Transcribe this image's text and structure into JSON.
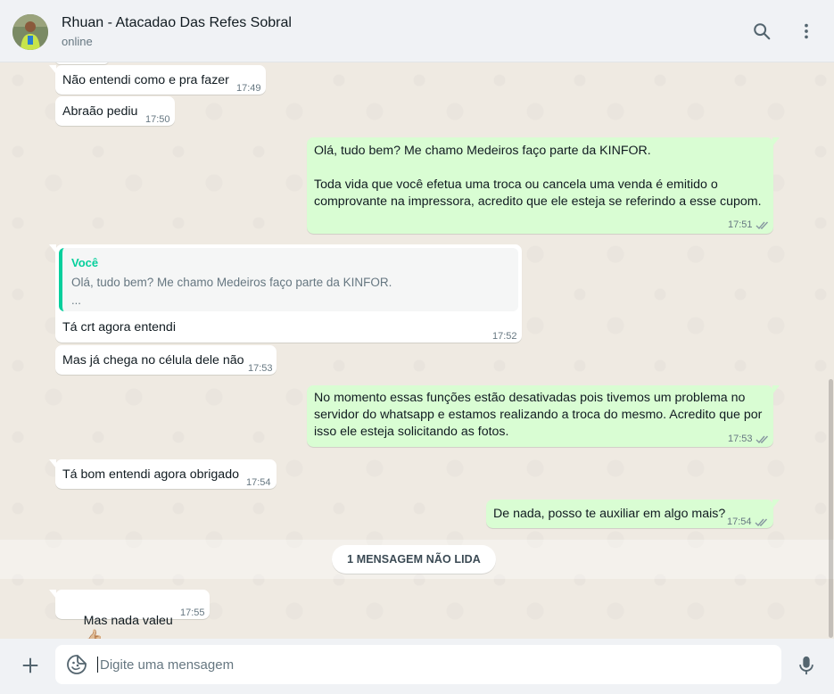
{
  "header": {
    "contact_name": "Rhuan - Atacadao Das Refes Sobral",
    "status": "online",
    "icons": [
      "search-icon",
      "menu-dots-icon"
    ]
  },
  "messages": [
    {
      "direction": "in",
      "text": "Não entendi como e pra fazer",
      "time": "17:49"
    },
    {
      "direction": "in",
      "text": "Abraão pediu",
      "time": "17:50"
    },
    {
      "direction": "out",
      "text": "Olá, tudo bem? Me chamo Medeiros faço parte da KINFOR.\n\nToda vida que você efetua uma troca ou cancela uma venda é emitido o\ncomprovante na impressora, acredito que ele esteja se referindo a esse cupom.",
      "time": "17:51",
      "status": "read"
    },
    {
      "direction": "in",
      "quote": {
        "author": "Você",
        "text": "Olá, tudo bem? Me chamo Medeiros faço parte da KINFOR.",
        "more": "..."
      },
      "text": "Tá crt agora entendi",
      "time": "17:52"
    },
    {
      "direction": "in",
      "text": "Mas já chega no célula dele não",
      "time": "17:53"
    },
    {
      "direction": "out",
      "text": "No momento essas funções estão desativadas pois tivemos um problema no\nservidor do whatsapp e estamos realizando a troca do mesmo. Acredito que por\nisso ele esteja solicitando as fotos.",
      "time": "17:53",
      "status": "read"
    },
    {
      "direction": "in",
      "text": "Tá bom entendi agora obrigado",
      "time": "17:54"
    },
    {
      "direction": "out",
      "text": "De nada, posso te auxiliar em algo mais?",
      "time": "17:54",
      "status": "read"
    },
    {
      "direction": "in",
      "text": "Mas nada valeu",
      "emoji": "👍🏼",
      "time": "17:55"
    }
  ],
  "unread_divider": "1 MENSAGEM NÃO LIDA",
  "composer": {
    "placeholder": "Digite uma mensagem",
    "icons": [
      "plus-icon",
      "emoji-sticker-icon",
      "microphone-icon"
    ]
  },
  "colors": {
    "incoming_bubble": "#ffffff",
    "outgoing_bubble": "#d9fdd3",
    "read_ticks": "#8696a0",
    "quote_accent": "#06cf9c",
    "chat_background": "#efeae2"
  }
}
